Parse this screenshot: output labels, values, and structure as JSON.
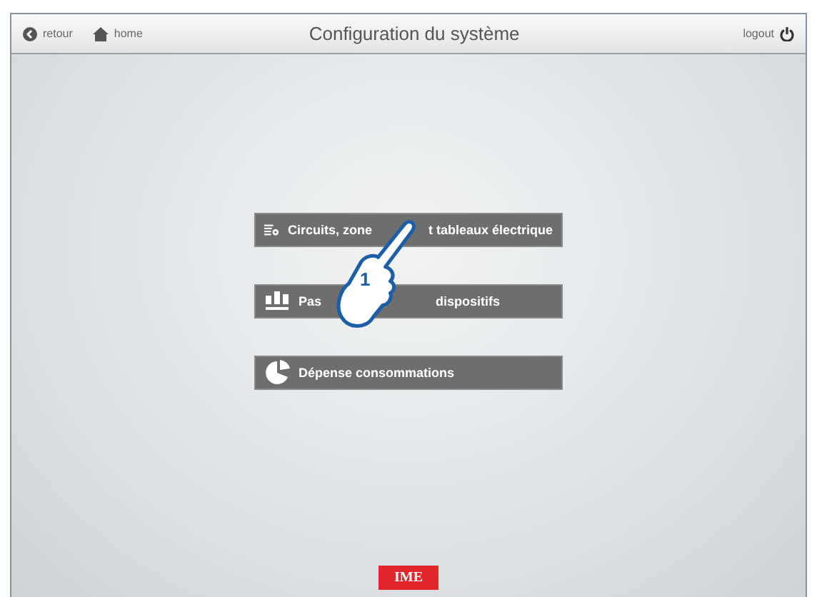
{
  "header": {
    "back": "retour",
    "home": "home",
    "title": "Configuration du système",
    "logout": "logout"
  },
  "menu": [
    {
      "kind": "circuits",
      "parts": [
        "Circuits, zone",
        "t tableaux électrique"
      ]
    },
    {
      "kind": "parameters",
      "parts": [
        "Pas",
        "dispositifs"
      ]
    },
    {
      "kind": "consumption",
      "parts": [
        "Dépense consommations"
      ]
    }
  ],
  "callout": {
    "step": "1"
  },
  "logo": "IME"
}
